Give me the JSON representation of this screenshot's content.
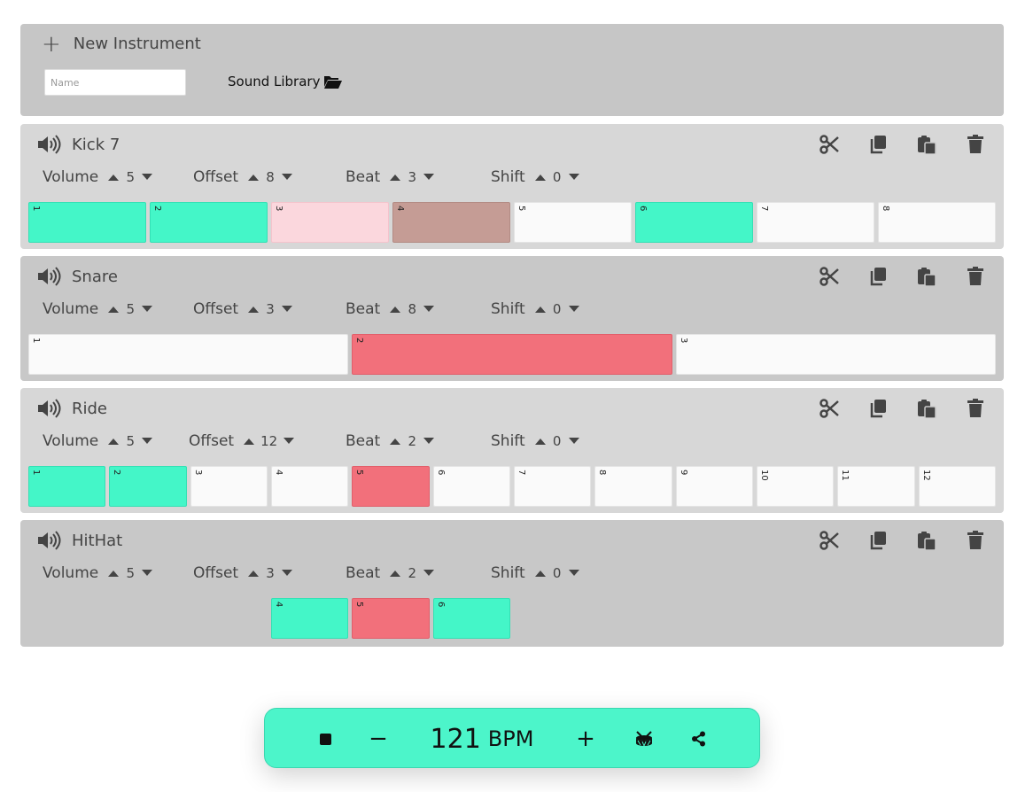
{
  "new_instrument": {
    "title": "New Instrument",
    "name_placeholder": "Name",
    "sound_library_label": "Sound Library"
  },
  "control_labels": {
    "volume": "Volume",
    "offset": "Offset",
    "beat": "Beat",
    "shift": "Shift"
  },
  "instruments": [
    {
      "name": "Kick 7",
      "volume": "5",
      "offset": "8",
      "beat": "3",
      "shift": "0",
      "steps": [
        {
          "label": "1",
          "state": "on"
        },
        {
          "label": "2",
          "state": "on"
        },
        {
          "label": "3",
          "state": "soft"
        },
        {
          "label": "4",
          "state": "brown"
        },
        {
          "label": "5",
          "state": "off"
        },
        {
          "label": "6",
          "state": "on"
        },
        {
          "label": "7",
          "state": "off"
        },
        {
          "label": "8",
          "state": "off"
        }
      ]
    },
    {
      "name": "Snare",
      "volume": "5",
      "offset": "3",
      "beat": "8",
      "shift": "0",
      "steps": [
        {
          "label": "1",
          "state": "off"
        },
        {
          "label": "2",
          "state": "accent"
        },
        {
          "label": "3",
          "state": "off"
        }
      ]
    },
    {
      "name": "Ride",
      "volume": "5",
      "offset": "12",
      "beat": "2",
      "shift": "0",
      "steps": [
        {
          "label": "1",
          "state": "on"
        },
        {
          "label": "2",
          "state": "on"
        },
        {
          "label": "3",
          "state": "off"
        },
        {
          "label": "4",
          "state": "off"
        },
        {
          "label": "5",
          "state": "accent"
        },
        {
          "label": "6",
          "state": "off"
        },
        {
          "label": "7",
          "state": "off"
        },
        {
          "label": "8",
          "state": "off"
        },
        {
          "label": "9",
          "state": "off"
        },
        {
          "label": "10",
          "state": "off"
        },
        {
          "label": "11",
          "state": "off"
        },
        {
          "label": "12",
          "state": "off"
        }
      ]
    },
    {
      "name": "HitHat",
      "volume": "5",
      "offset": "3",
      "beat": "2",
      "shift": "0",
      "steps": [
        {
          "label": "",
          "state": "faded"
        },
        {
          "label": "",
          "state": "faded"
        },
        {
          "label": "",
          "state": "faded"
        },
        {
          "label": "4",
          "state": "on"
        },
        {
          "label": "5",
          "state": "accent"
        },
        {
          "label": "6",
          "state": "on"
        },
        {
          "label": "",
          "state": "faded"
        },
        {
          "label": "",
          "state": "faded"
        },
        {
          "label": "",
          "state": "faded"
        },
        {
          "label": "",
          "state": "faded"
        },
        {
          "label": "",
          "state": "faded"
        },
        {
          "label": "",
          "state": "faded"
        }
      ]
    }
  ],
  "transport": {
    "bpm": "121",
    "bpm_unit": "BPM",
    "minus_label": "−",
    "plus_label": "+"
  },
  "colors": {
    "step_on": "#44f6c8",
    "step_accent": "#f2707b",
    "transport_bg": "#4cf5ca"
  }
}
